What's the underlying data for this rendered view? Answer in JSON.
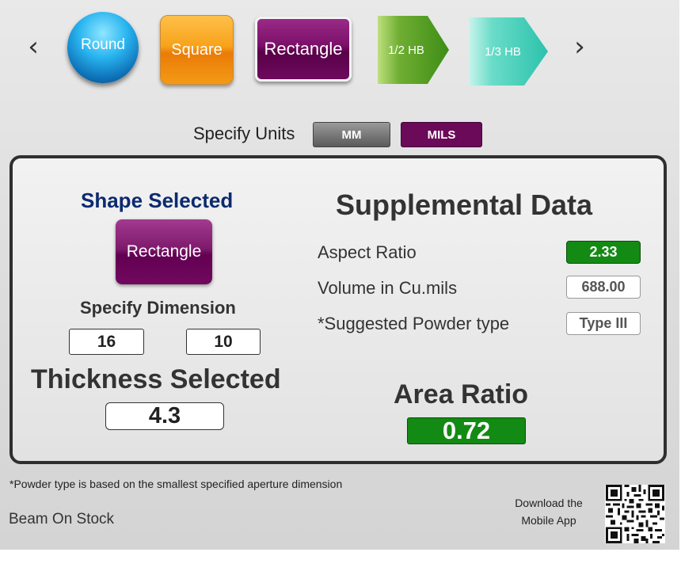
{
  "carousel": {
    "prev_icon": "chevron-left-icon",
    "next_icon": "chevron-right-icon",
    "shapes": {
      "round": "Round",
      "square": "Square",
      "rectangle": "Rectangle",
      "half_hb": "1/2 HB",
      "third_hb": "1/3 HB"
    }
  },
  "units": {
    "label": "Specify Units",
    "mm": "MM",
    "mils": "MILS",
    "selected": "MILS"
  },
  "left_panel": {
    "shape_selected_title": "Shape Selected",
    "selected_shape": "Rectangle",
    "specify_dimension_label": "Specify Dimension",
    "dimension_1": "16",
    "dimension_2": "10",
    "thickness_title": "Thickness Selected",
    "thickness_value": "4.3"
  },
  "supplemental": {
    "title": "Supplemental Data",
    "aspect_ratio_label": "Aspect Ratio",
    "aspect_ratio_value": "2.33",
    "volume_label": "Volume in Cu.mils",
    "volume_value": "688.00",
    "powder_label": "*Suggested Powder type",
    "powder_value": "Type III",
    "area_ratio_title": "Area Ratio",
    "area_ratio_value": "0.72"
  },
  "footer": {
    "footnote": "*Powder type is based on the smallest specified aperture dimension",
    "company": "Beam On Stock",
    "download_line1": "Download the",
    "download_line2": "Mobile App",
    "qr_icon": "qr-code-icon"
  },
  "colors": {
    "accent_purple": "#6a0a58",
    "good_green": "#138a13",
    "title_navy": "#0c2a6e"
  }
}
